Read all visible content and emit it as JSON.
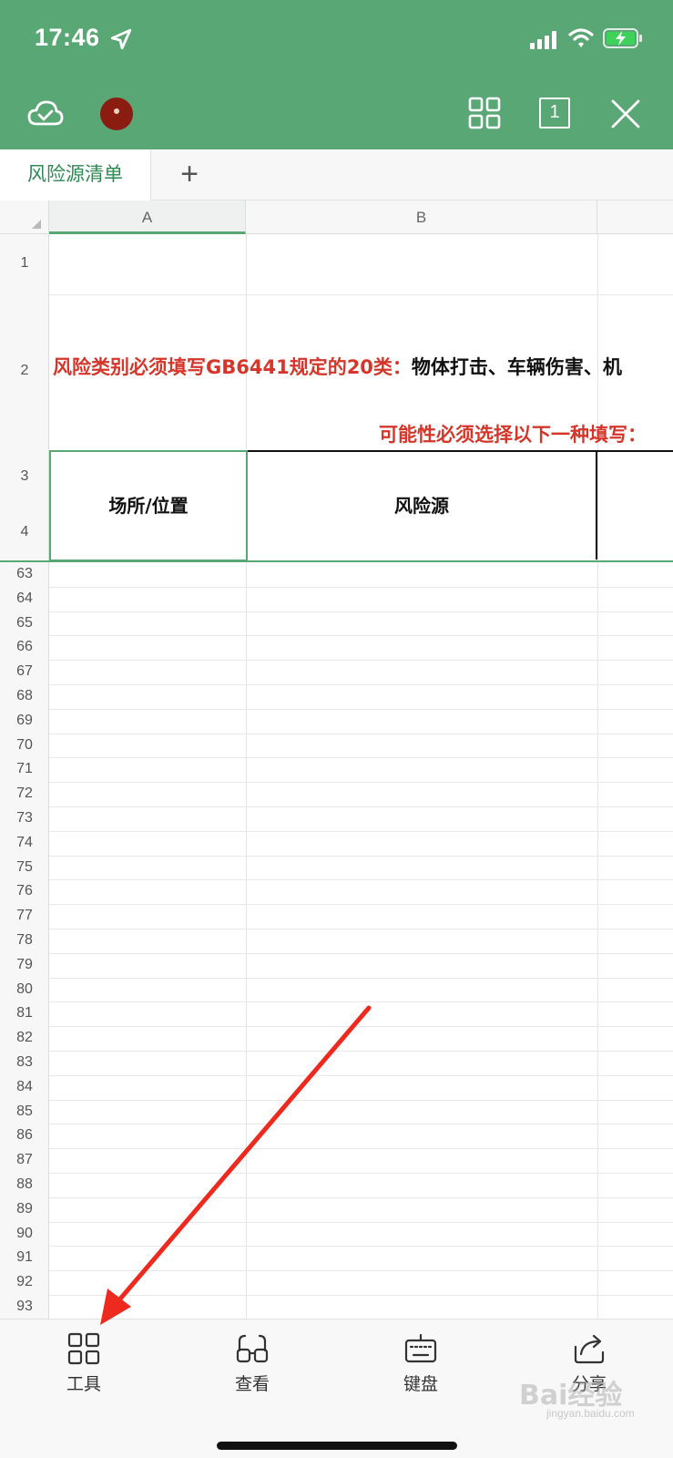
{
  "status_bar": {
    "time": "17:46"
  },
  "toolbar": {
    "sheet_count": "1"
  },
  "tabs": {
    "active": "风险源清单",
    "add_label": "+"
  },
  "columns": [
    "A",
    "B"
  ],
  "rows": {
    "top": [
      "1",
      "2",
      "3",
      "4"
    ],
    "list": [
      "63",
      "64",
      "65",
      "66",
      "67",
      "68",
      "69",
      "70",
      "71",
      "72",
      "73",
      "74",
      "75",
      "76",
      "77",
      "78",
      "79",
      "80",
      "81",
      "82",
      "83",
      "84",
      "85",
      "86",
      "87",
      "88",
      "89",
      "90",
      "91",
      "92",
      "93"
    ]
  },
  "cells": {
    "row2_red": "风险类别必须填写GB6441规定的20类：",
    "row2_black": "物体打击、车辆伤害、机",
    "row2_second": "可能性必须选择以下一种填写：",
    "header_a": "场所/位置",
    "header_b": "风险源"
  },
  "bottom_bar": {
    "tools": "工具",
    "view": "查看",
    "keyboard": "键盘",
    "share": "分享"
  },
  "watermark": {
    "main": "Bai经验",
    "sub": "jingyan.baidu.com"
  },
  "colors": {
    "accent": "#58a774",
    "red_text": "#d6362a",
    "annotation_arrow": "#ee2a1f"
  }
}
